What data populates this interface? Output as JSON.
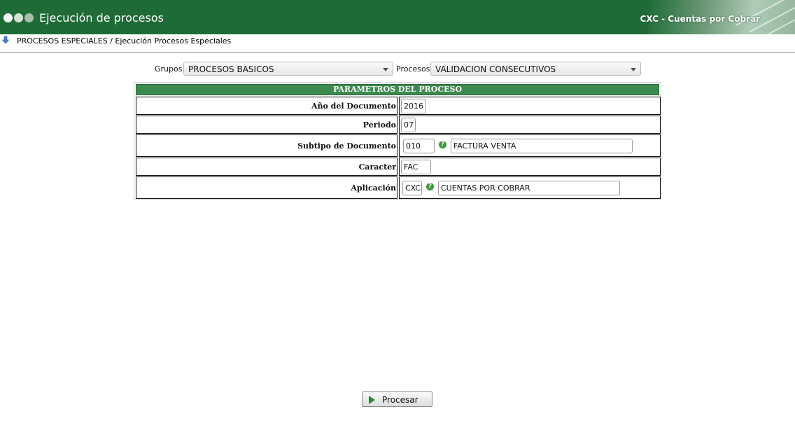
{
  "header": {
    "title": "Ejecución de procesos",
    "module": "CXC - Cuentas por Cobrar",
    "colors": {
      "bar": "#1e6b36",
      "table_head": "#3d8a4f",
      "help_icon": "#3f9a3a"
    }
  },
  "breadcrumb": {
    "text": "PROCESOS ESPECIALES / Ejecución Procesos Especiales",
    "icon": "download-arrow-icon"
  },
  "filters": {
    "grupos_label": "Grupos:",
    "grupos_value": "PROCESOS BASICOS",
    "procesos_label": "Procesos:",
    "procesos_value": "VALIDACION CONSECUTIVOS"
  },
  "params": {
    "title": "PARAMETROS DEL PROCESO",
    "rows": [
      {
        "label": "Año del Documento",
        "value": "2016"
      },
      {
        "label": "Periodo",
        "value": "07"
      },
      {
        "label": "Subtipo de Documento",
        "value": "010",
        "help_icon": "help-icon",
        "description": "FACTURA VENTA"
      },
      {
        "label": "Caracter",
        "value": "FAC"
      },
      {
        "label": "Aplicación",
        "value": "CXC",
        "help_icon": "help-icon",
        "description": "CUENTAS POR COBRAR"
      }
    ]
  },
  "actions": {
    "process_label": "Procesar",
    "process_icon": "play-icon"
  }
}
